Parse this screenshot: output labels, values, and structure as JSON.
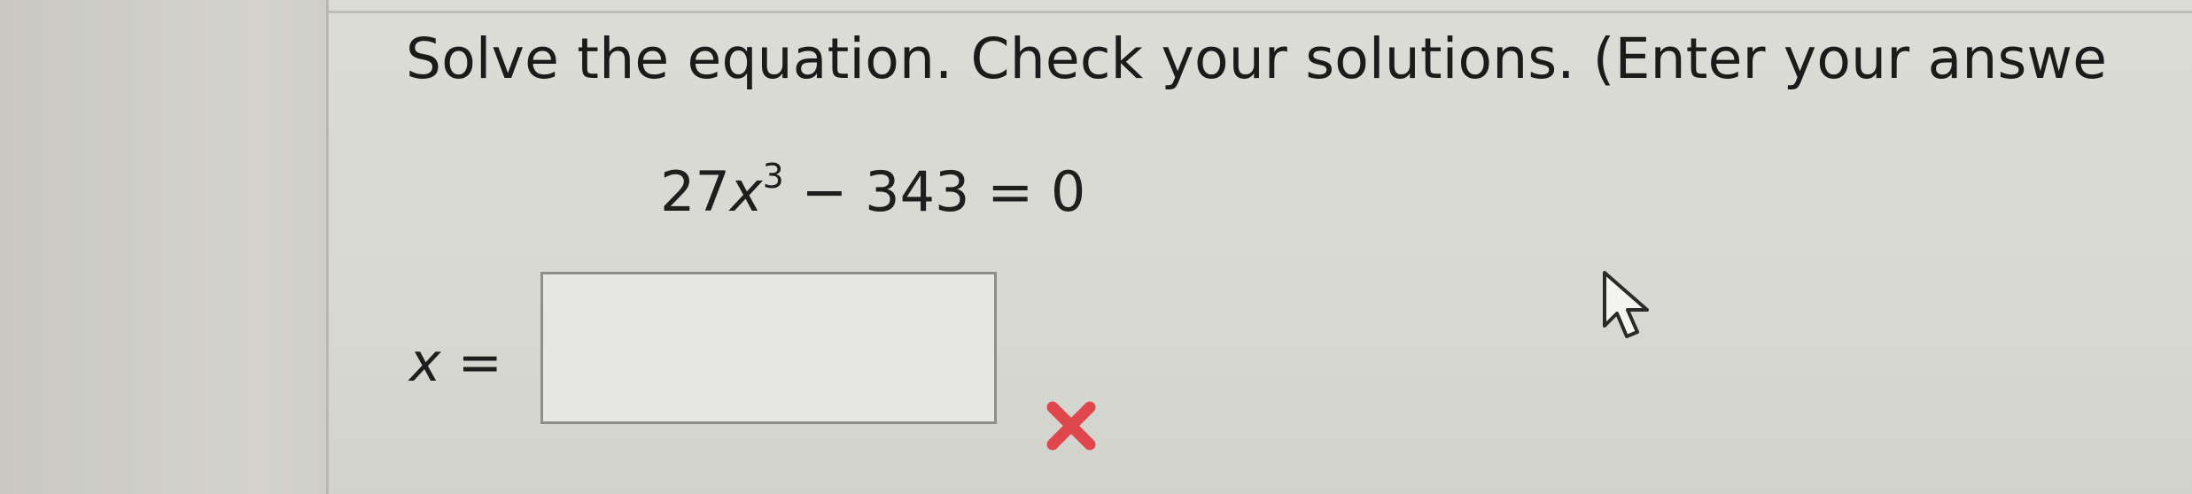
{
  "question": {
    "instruction": "Solve the equation. Check your solutions. (Enter your answe",
    "equation": {
      "coefficient": "27",
      "variable": "x",
      "exponent": "3",
      "rest": " − 343 = 0"
    }
  },
  "answer": {
    "variable": "x",
    "equals": " =",
    "value": ""
  },
  "icons": {
    "status": "wrong-x-icon",
    "status_color": "#e0474c",
    "pointer": "mouse-cursor-icon"
  }
}
